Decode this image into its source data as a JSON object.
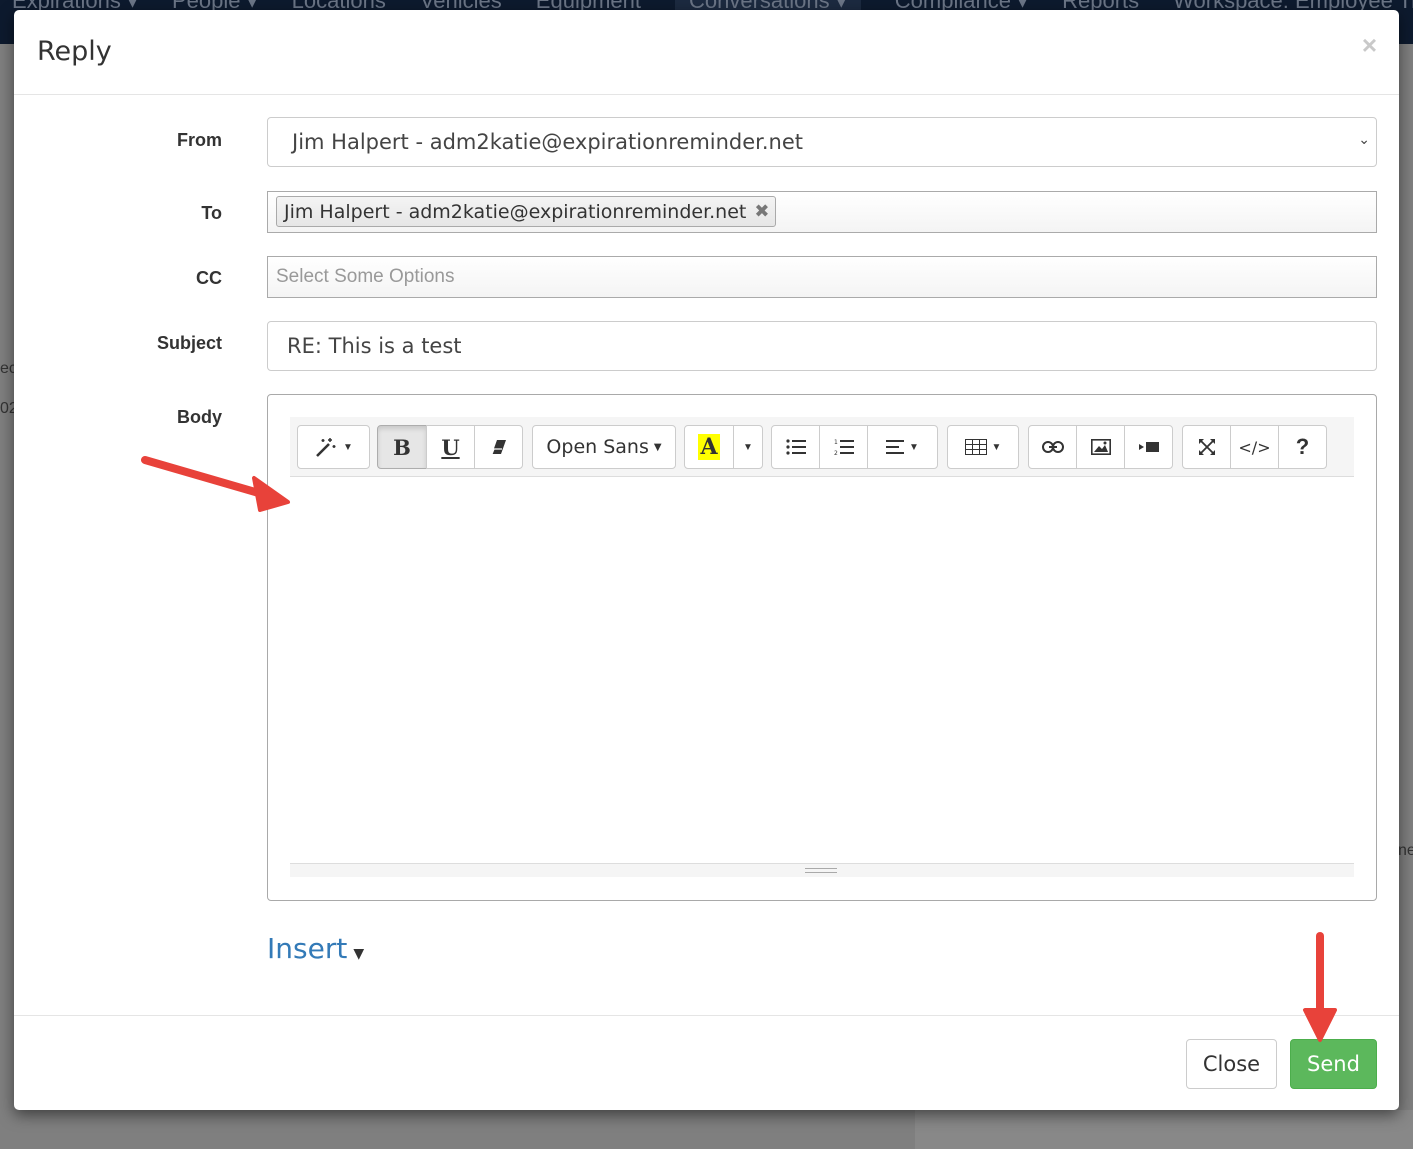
{
  "background": {
    "nav_items": [
      "Expirations ▾",
      "People ▾",
      "Locations",
      "Vehicles",
      "Equipment",
      "Conversations ▾",
      "Compliance ▾",
      "Reports",
      "Workspace: Employee Trai"
    ],
    "edge_text_1": "ec",
    "edge_text_2": "02",
    "edge_text_3": "ne"
  },
  "modal": {
    "title": "Reply",
    "close_glyph": "×"
  },
  "form": {
    "from": {
      "label": "From",
      "value": "Jim Halpert - adm2katie@expirationreminder.net"
    },
    "to": {
      "label": "To",
      "tags": [
        {
          "text": "Jim Halpert - adm2katie@expirationreminder.net"
        }
      ],
      "remove_glyph": "✖"
    },
    "cc": {
      "label": "CC",
      "placeholder": "Select Some Options"
    },
    "subject": {
      "label": "Subject",
      "value": "RE: This is a test"
    },
    "body": {
      "label": "Body"
    }
  },
  "editor": {
    "font_name": "Open Sans",
    "bold": "B",
    "underline": "U",
    "highlight": "A"
  },
  "insert": {
    "label": "Insert"
  },
  "footer": {
    "close_label": "Close",
    "send_label": "Send"
  },
  "colors": {
    "send": "#5cb85c",
    "link": "#337ab7",
    "annotation_arrow": "#e8423a",
    "highlight": "#ffff00"
  }
}
